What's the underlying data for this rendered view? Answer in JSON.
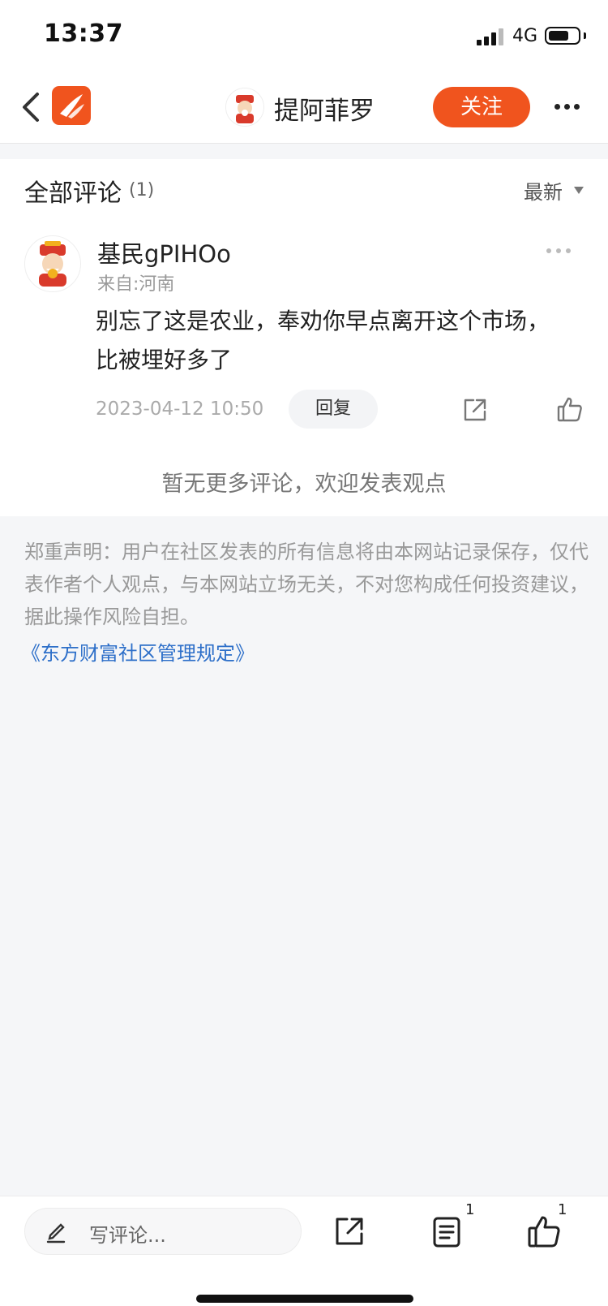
{
  "status_bar": {
    "time": "13:37",
    "network": "4G"
  },
  "nav": {
    "title": "提阿菲罗",
    "follow_label": "关注"
  },
  "comments": {
    "section_title": "全部评论",
    "count": "(1)",
    "sort_label": "最新",
    "items": [
      {
        "username": "基民gPIHOo",
        "location": "来自:河南",
        "text": "别忘了这是农业，奉劝你早点离开这个市场，比被埋好多了",
        "timestamp": "2023-04-12 10:50",
        "reply_label": "回复"
      }
    ],
    "empty_more": "暂无更多评论，欢迎发表观点"
  },
  "disclaimer": {
    "text": "郑重声明：用户在社区发表的所有信息将由本网站记录保存，仅代表作者个人观点，与本网站立场无关，不对您构成任何投资建议，据此操作风险自担。",
    "link": "《东方财富社区管理规定》"
  },
  "bottom_bar": {
    "input_placeholder": "写评论...",
    "list_count": "1",
    "like_count": "1"
  },
  "colors": {
    "accent": "#f0541e",
    "link": "#2d6fc9"
  }
}
